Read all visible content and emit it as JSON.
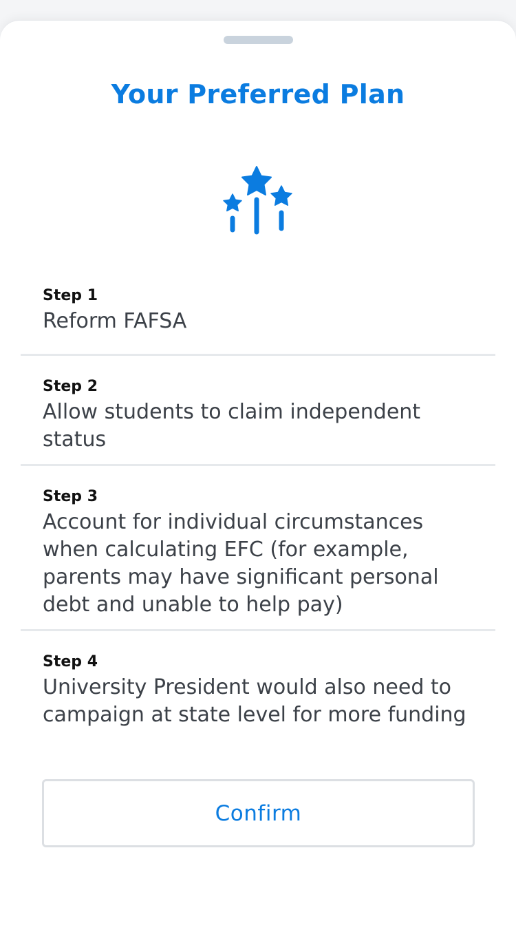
{
  "header": {
    "title": "Your Preferred Plan",
    "icon": "stars-icon"
  },
  "steps": [
    {
      "label": "Step 1",
      "text": "Reform FAFSA"
    },
    {
      "label": "Step 2",
      "text": "Allow students to claim independent status"
    },
    {
      "label": "Step 3",
      "text": "Account for individual circumstances when calculating EFC (for example, parents may have significant personal debt and unable to help pay)"
    },
    {
      "label": "Step 4",
      "text": "University President would also need to campaign at state level for more funding"
    }
  ],
  "actions": {
    "confirm_label": "Confirm"
  },
  "colors": {
    "accent": "#0b7ce0",
    "handle": "#c9d3dd",
    "divider": "#e6e9ec",
    "body_text": "#3c4148"
  }
}
